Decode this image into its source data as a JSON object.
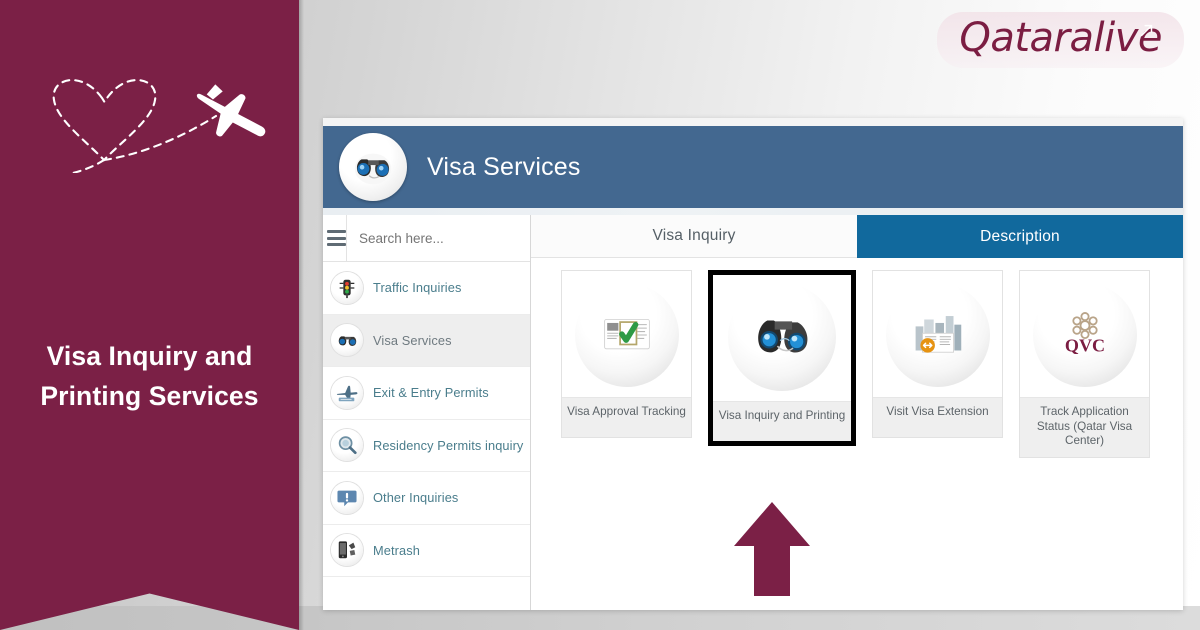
{
  "banner": {
    "title": "Visa Inquiry and\nPrinting Services",
    "title_line1": "Visa Inquiry and",
    "title_line2": "Printing Services",
    "bg_color": "#7b2046",
    "decoration_icon": "heart-dashed-flight-path-icon",
    "plane_icon": "airplane-icon"
  },
  "logo": {
    "text": "Qataralive",
    "color": "#7b1d42",
    "arrow_icon": "arrow-up-right-icon"
  },
  "app": {
    "header": {
      "title": "Visa Services",
      "logo_icon": "binoculars-globe-icon",
      "bg_color": "#436890"
    },
    "search": {
      "placeholder": "Search here...",
      "value": "",
      "menu_icon": "hamburger-menu-icon"
    },
    "sidebar": {
      "items": [
        {
          "label": "Traffic Inquiries",
          "icon": "traffic-light-icon",
          "selected": false
        },
        {
          "label": "Visa Services",
          "icon": "binoculars-globe-icon",
          "selected": true
        },
        {
          "label": "Exit & Entry Permits",
          "icon": "airplane-permit-icon",
          "selected": false
        },
        {
          "label": "Residency Permits inquiry",
          "icon": "magnifier-icon",
          "selected": false
        },
        {
          "label": "Other Inquiries",
          "icon": "exclamation-bubble-icon",
          "selected": false
        },
        {
          "label": "Metrash",
          "icon": "mobile-phone-icon",
          "selected": false
        }
      ]
    },
    "tabs": [
      {
        "label": "Visa Inquiry",
        "active": false
      },
      {
        "label": "Description",
        "active": true,
        "color": "#11699d"
      }
    ],
    "cards": [
      {
        "label": "Visa Approval Tracking",
        "icon": "document-green-check-icon",
        "highlighted": false
      },
      {
        "label": "Visa Inquiry and Printing",
        "icon": "binoculars-icon",
        "highlighted": true
      },
      {
        "label": "Visit Visa Extension",
        "icon": "city-document-extend-icon",
        "highlighted": false
      },
      {
        "label": "Track Application Status (Qatar Visa Center)",
        "icon": "qvc-logo-icon",
        "highlighted": false
      }
    ],
    "annotation": {
      "arrow_icon": "up-arrow-annotation-icon",
      "arrow_color": "#7b2046",
      "points_to": "Visa Inquiry and Printing"
    }
  }
}
